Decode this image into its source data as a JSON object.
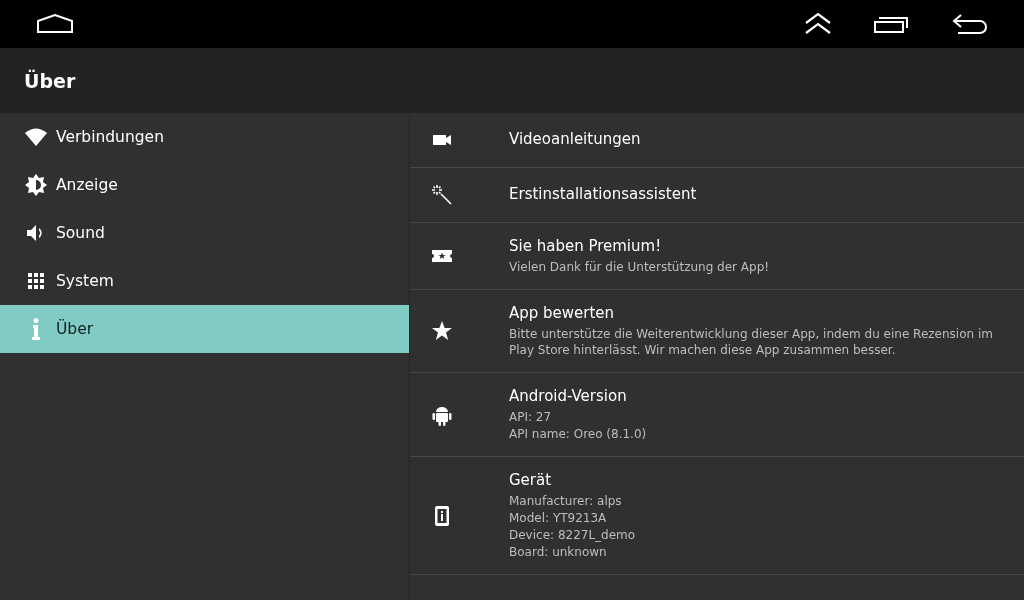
{
  "header": {
    "title": "Über"
  },
  "sidebar": {
    "items": [
      {
        "label": "Verbindungen",
        "kind": "wifi",
        "selected": false
      },
      {
        "label": "Anzeige",
        "kind": "brightness",
        "selected": false
      },
      {
        "label": "Sound",
        "kind": "sound",
        "selected": false
      },
      {
        "label": "System",
        "kind": "grid",
        "selected": false
      },
      {
        "label": "Über",
        "kind": "info",
        "selected": true
      }
    ]
  },
  "settings": [
    {
      "title": "Videoanleitungen",
      "kind": "video"
    },
    {
      "title": "Erstinstallationsassistent",
      "kind": "wand"
    },
    {
      "title": "Sie haben Premium!",
      "kind": "ticket",
      "lines": [
        "Vielen Dank für die Unterstützung der App!"
      ]
    },
    {
      "title": "App bewerten",
      "kind": "star",
      "lines": [
        "Bitte unterstütze die Weiterentwicklung dieser App, indem du eine Rezension im Play Store hinterlässt. Wir machen diese App zusammen besser."
      ]
    },
    {
      "title": "Android-Version",
      "kind": "android",
      "lines": [
        "API: 27",
        "API name: Oreo (8.1.0)"
      ]
    },
    {
      "title": "Gerät",
      "kind": "device",
      "lines": [
        "Manufacturer: alps",
        "Model: YT9213A",
        "Device: 8227L_demo",
        "Board: unknown"
      ]
    }
  ]
}
